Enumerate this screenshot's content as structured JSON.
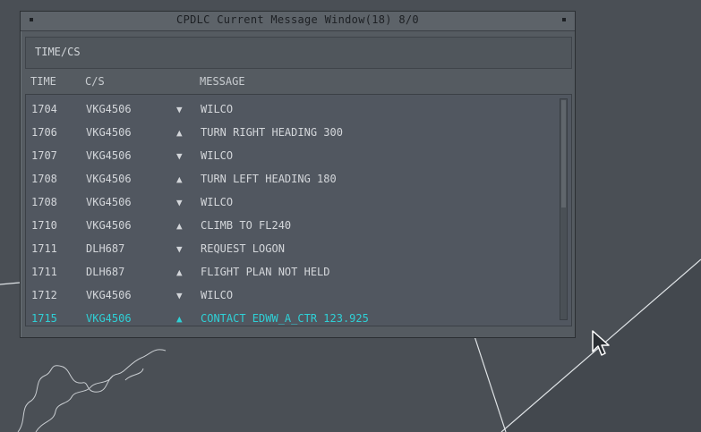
{
  "window": {
    "title": "CPDLC Current Message Window(18) 8/0"
  },
  "header": {
    "time_cs_label": "TIME/CS"
  },
  "columns": {
    "time": "TIME",
    "cs": "C/S",
    "message": "MESSAGE"
  },
  "messages": [
    {
      "time": "1704",
      "cs": "VKG4506",
      "dir": "down",
      "arrow": "▼",
      "text": "WILCO"
    },
    {
      "time": "1706",
      "cs": "VKG4506",
      "dir": "up",
      "arrow": "▲",
      "text": "TURN RIGHT HEADING 300"
    },
    {
      "time": "1707",
      "cs": "VKG4506",
      "dir": "down",
      "arrow": "▼",
      "text": "WILCO"
    },
    {
      "time": "1708",
      "cs": "VKG4506",
      "dir": "up",
      "arrow": "▲",
      "text": "TURN LEFT HEADING 180"
    },
    {
      "time": "1708",
      "cs": "VKG4506",
      "dir": "down",
      "arrow": "▼",
      "text": "WILCO"
    },
    {
      "time": "1710",
      "cs": "VKG4506",
      "dir": "up",
      "arrow": "▲",
      "text": "CLIMB TO FL240"
    },
    {
      "time": "1711",
      "cs": "DLH687",
      "dir": "down",
      "arrow": "▼",
      "text": "REQUEST LOGON"
    },
    {
      "time": "1711",
      "cs": "DLH687",
      "dir": "up",
      "arrow": "▲",
      "text": "FLIGHT PLAN NOT HELD"
    },
    {
      "time": "1712",
      "cs": "VKG4506",
      "dir": "down",
      "arrow": "▼",
      "text": "WILCO"
    },
    {
      "time": "1715",
      "cs": "VKG4506",
      "dir": "up",
      "arrow": "▲",
      "text": "CONTACT EDWW_A_CTR 123.925",
      "active": true
    }
  ],
  "colors": {
    "background": "#4a4f55",
    "window": "#555b61",
    "text": "#d3d6da",
    "active_message": "#2fd0d6"
  }
}
